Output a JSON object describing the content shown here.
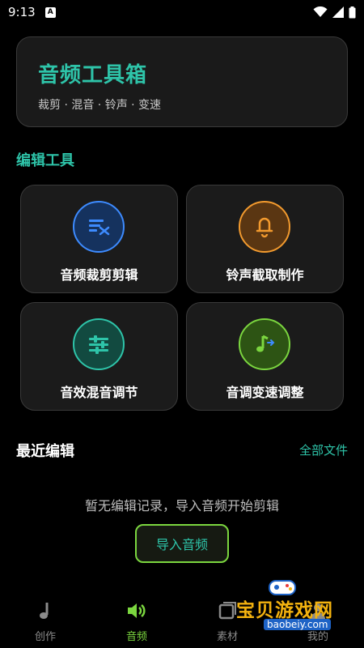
{
  "status": {
    "time": "9:13",
    "notification_glyph": "A"
  },
  "hero": {
    "title": "音频工具箱",
    "subtitle": "裁剪 · 混音 · 铃声 · 变速"
  },
  "tools_section": {
    "title": "编辑工具"
  },
  "tools": [
    {
      "label": "音频裁剪剪辑",
      "icon": "text-lines-icon",
      "color": "#3d8bff"
    },
    {
      "label": "铃声截取制作",
      "icon": "bell-icon",
      "color": "#f29a2e"
    },
    {
      "label": "音效混音调节",
      "icon": "sliders-icon",
      "color": "#2ec4a9"
    },
    {
      "label": "音调变速调整",
      "icon": "music-note-icon",
      "color": "#7bd63f"
    }
  ],
  "recent": {
    "title": "最近编辑",
    "all_link": "全部文件",
    "empty_text": "暂无编辑记录，导入音频开始剪辑",
    "import_button": "导入音频"
  },
  "nav": [
    {
      "label": "创作",
      "icon": "music-note-icon",
      "active": false
    },
    {
      "label": "音频",
      "icon": "speaker-icon",
      "active": true
    },
    {
      "label": "素材",
      "icon": "layers-icon",
      "active": false
    },
    {
      "label": "我的",
      "icon": "user-icon",
      "active": false
    }
  ],
  "watermark": {
    "text": "宝贝游戏网",
    "url": "baobeiy.com"
  },
  "colors": {
    "accent_teal": "#2ec4a9",
    "accent_green": "#7bd63f",
    "card_bg": "#1b1b1b"
  }
}
